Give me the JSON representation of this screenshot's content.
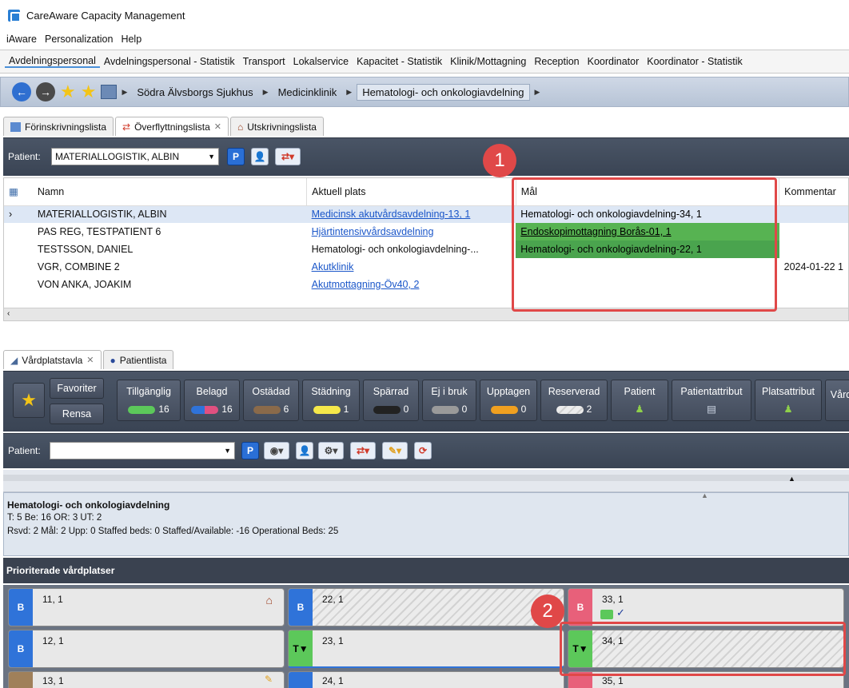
{
  "app": {
    "title": "CareAware Capacity Management"
  },
  "menu": [
    "iAware",
    "Personalization",
    "Help"
  ],
  "perspectives": [
    "Avdelningspersonal",
    "Avdelningspersonal - Statistik",
    "Transport",
    "Lokalservice",
    "Kapacitet - Statistik",
    "Klinik/Mottagning",
    "Reception",
    "Koordinator",
    "Koordinator - Statistik"
  ],
  "breadcrumb": [
    "Södra Älvsborgs Sjukhus",
    "Medicinklinik",
    "Hematologi- och onkologiavdelning"
  ],
  "upper_tabs": [
    "Förinskrivningslista",
    "Överflyttningslista",
    "Utskrivningslista"
  ],
  "patient_bar": {
    "label": "Patient:",
    "value": "MATERIALLOGISTIK, ALBIN",
    "p": "P"
  },
  "transfer_table": {
    "headers": [
      "Namn",
      "Aktuell plats",
      "Mål",
      "Kommentar"
    ],
    "rows": [
      {
        "name": "MATERIALLOGISTIK, ALBIN",
        "place": "Medicinsk akutvårdsavdelning-13, 1",
        "goal": "Hematologi- och onkologiavdelning-34, 1",
        "comment": ""
      },
      {
        "name": "PAS REG, TESTPATIENT 6",
        "place": "Hjärtintensivvårdsavdelning",
        "goal": "Endoskopimottagning Borås-01, 1",
        "comment": ""
      },
      {
        "name": "TESTSSON, DANIEL",
        "place": "Hematologi- och onkologiavdelning-...",
        "goal": "Hematologi- och onkologiavdelning-22, 1",
        "comment": ""
      },
      {
        "name": "VGR, COMBINE 2",
        "place": "Akutklinik",
        "goal": "",
        "comment": "2024-01-22 1"
      },
      {
        "name": "VON ANKA, JOAKIM",
        "place": "Akutmottagning-Öv40, 2",
        "goal": "",
        "comment": ""
      }
    ]
  },
  "callouts": [
    "1",
    "2"
  ],
  "lower_tabs": [
    "Vårdplatstavla",
    "Patientlista"
  ],
  "filters": {
    "favorites": "Favoriter",
    "clear": "Rensa",
    "items": [
      {
        "label": "Tillgänglig",
        "count": "16",
        "color": "#5cc85a"
      },
      {
        "label": "Belagd",
        "count": "16",
        "color": "#e05080"
      },
      {
        "label": "Ostädad",
        "count": "6",
        "color": "#8a6a4a"
      },
      {
        "label": "Städning",
        "count": "1",
        "color": "#f5e84a"
      },
      {
        "label": "Spärrad",
        "count": "0",
        "color": "#222222"
      },
      {
        "label": "Ej i bruk",
        "count": "0",
        "color": "#9a9a9a"
      },
      {
        "label": "Upptagen",
        "count": "0",
        "color": "#f0a020"
      },
      {
        "label": "Reserverad",
        "count": "2",
        "color": "#cccccc"
      }
    ],
    "extra": [
      "Patient",
      "Patientattribut",
      "Platsattribut",
      "Vård"
    ]
  },
  "patient_bar2": {
    "label": "Patient:",
    "p": "P"
  },
  "ward": {
    "name": "Hematologi- och onkologiavdelning",
    "line1": "T: 5 Be: 16 OR: 3 UT: 2",
    "line2": "Rsvd: 2 Mål: 2 Upp: 0 Staffed beds: 0 Staffed/Available: -16 Operational Beds: 25"
  },
  "prioritized_header": "Prioriterade vårdplatser",
  "beds": [
    {
      "num": "11, 1",
      "tag": "B",
      "color": "#2f73d9"
    },
    {
      "num": "22, 1",
      "tag": "B",
      "color": "#2f73d9"
    },
    {
      "num": "33, 1",
      "tag": "B",
      "color": "#e8607a"
    },
    {
      "num": "12, 1",
      "tag": "B",
      "color": "#2f73d9"
    },
    {
      "num": "23, 1",
      "tag": "T▼",
      "color": "#5cc85a"
    },
    {
      "num": "34, 1",
      "tag": "T▼",
      "color": "#5cc85a"
    },
    {
      "num": "13, 1",
      "tag": "",
      "color": "#a0805a"
    },
    {
      "num": "24, 1",
      "tag": "",
      "color": "#2f73d9"
    },
    {
      "num": "35, 1",
      "tag": "",
      "color": "#e8607a"
    }
  ]
}
